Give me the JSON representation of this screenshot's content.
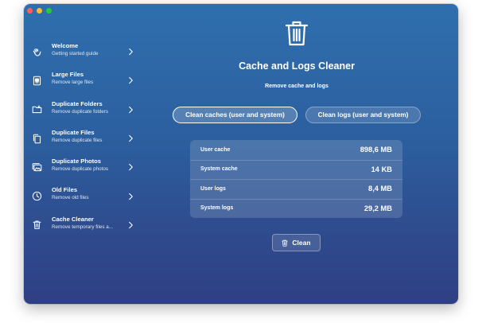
{
  "sidebar": {
    "items": [
      {
        "title": "Welcome",
        "subtitle": "Getting started guide",
        "icon": "hand-wave-icon"
      },
      {
        "title": "Large Files",
        "subtitle": "Remove large files",
        "icon": "large-file-icon"
      },
      {
        "title": "Duplicate Folders",
        "subtitle": "Remove duplicate folders",
        "icon": "folder-icon"
      },
      {
        "title": "Duplicate Files",
        "subtitle": "Remove duplicate files",
        "icon": "files-icon"
      },
      {
        "title": "Duplicate Photos",
        "subtitle": "Remove duplicate photos",
        "icon": "photo-icon"
      },
      {
        "title": "Old Files",
        "subtitle": "Remove old files",
        "icon": "clock-icon"
      },
      {
        "title": "Cache Cleaner",
        "subtitle": "Remove temporary files a...",
        "icon": "trash-icon"
      }
    ]
  },
  "main": {
    "title": "Cache and Logs Cleaner",
    "subtitle": "Remove cache and logs",
    "segments": [
      {
        "label": "Clean caches (user and system)",
        "selected": true
      },
      {
        "label": "Clean logs (user and system)",
        "selected": false
      }
    ],
    "stats": [
      {
        "label": "User cache",
        "value": "898,6 MB"
      },
      {
        "label": "System cache",
        "value": "14 KB"
      },
      {
        "label": "User logs",
        "value": "8,4 MB"
      },
      {
        "label": "System logs",
        "value": "29,2 MB"
      }
    ],
    "clean_label": "Clean"
  },
  "colors": {
    "background_top": "#2f6fae",
    "background_bottom": "#2f3f84",
    "text": "#ffffff"
  }
}
